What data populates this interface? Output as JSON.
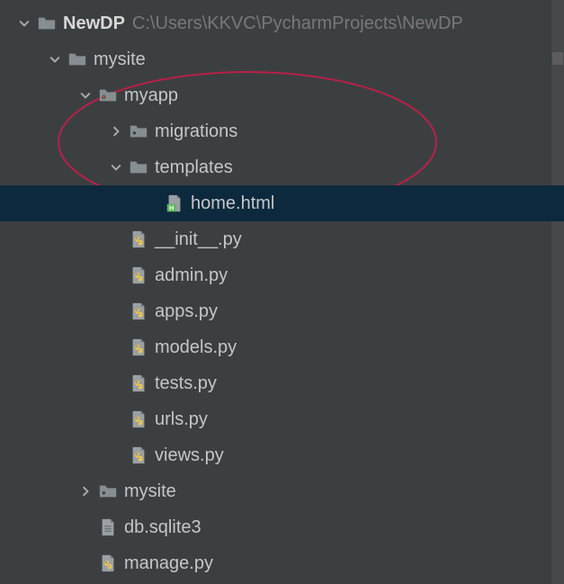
{
  "project": {
    "name": "NewDP",
    "path": "C:\\Users\\KKVC\\PycharmProjects\\NewDP"
  },
  "tree": {
    "mysite": {
      "label": "mysite",
      "myapp": {
        "label": "myapp",
        "migrations": "migrations",
        "templates": {
          "label": "templates",
          "home": "home.html"
        },
        "init": "__init__.py",
        "admin": "admin.py",
        "apps": "apps.py",
        "models": "models.py",
        "tests": "tests.py",
        "urls": "urls.py",
        "views": "views.py"
      },
      "mysite2": "mysite",
      "db": "db.sqlite3",
      "manage": "manage.py"
    }
  },
  "colors": {
    "folder": "#878e91",
    "folderSpecial": "#8a8f92",
    "pyBody": "#9aa0a3",
    "pyBadge": "#f0c84b",
    "htmlBody": "#9aa0a3",
    "htmlBadge": "#5db85b",
    "chevron": "#a9adaf",
    "ellipse": "#b6214a"
  }
}
